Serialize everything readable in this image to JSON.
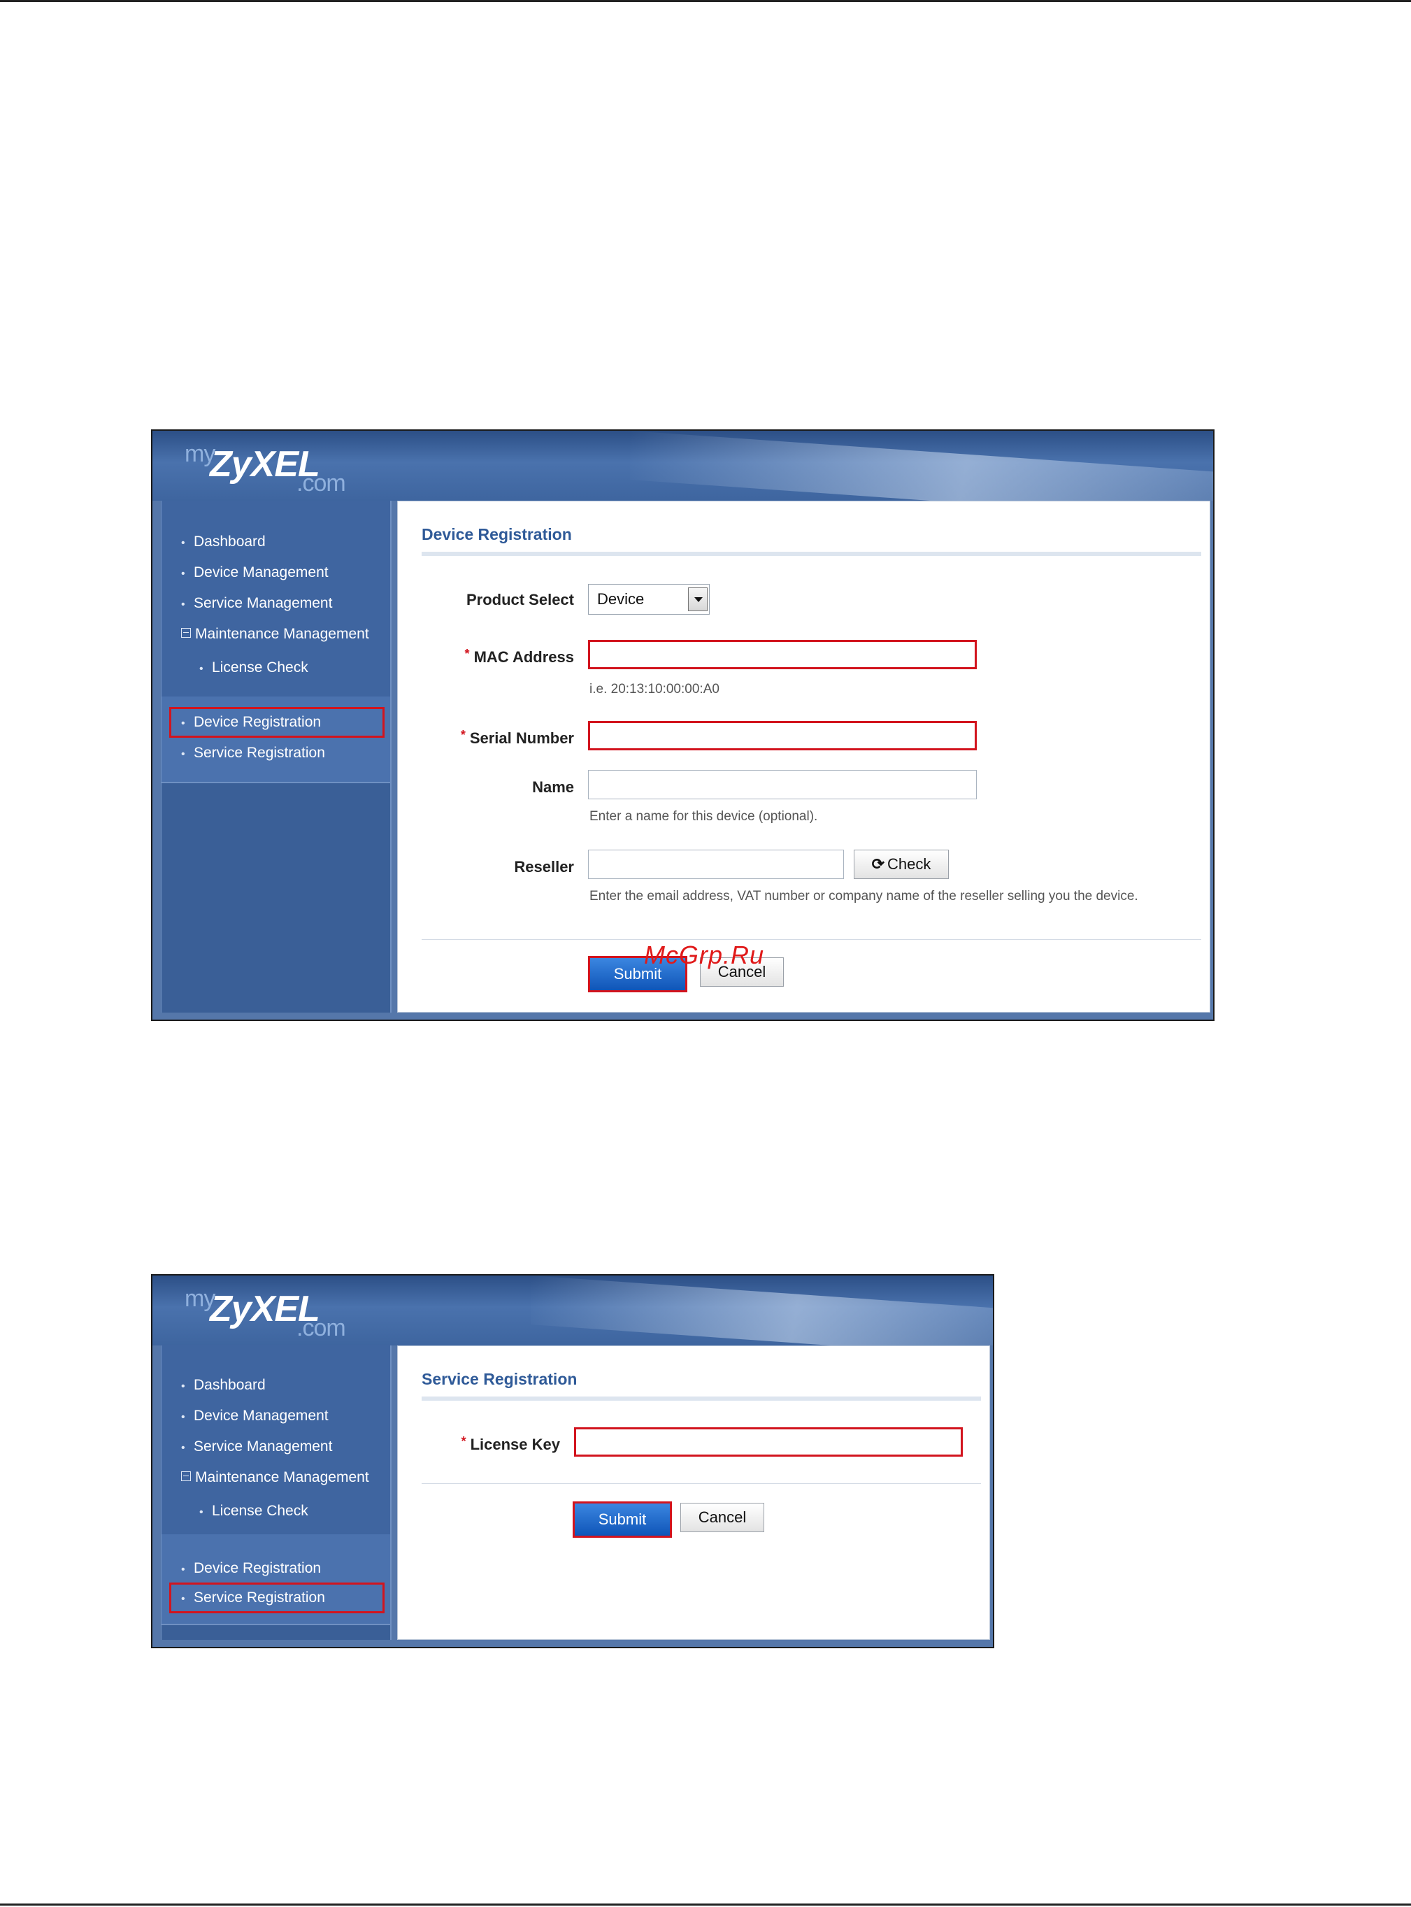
{
  "brand": {
    "my": "my",
    "name": "ZyXEL",
    "dotcom": ".com"
  },
  "sidebar": {
    "items": [
      {
        "label": "Dashboard"
      },
      {
        "label": "Device Management"
      },
      {
        "label": "Service Management"
      },
      {
        "label": "Maintenance Management"
      },
      {
        "label": "License Check"
      },
      {
        "label": "Device Registration"
      },
      {
        "label": "Service Registration"
      }
    ]
  },
  "device_registration": {
    "title": "Device Registration",
    "product_select": {
      "label": "Product Select",
      "value": "Device"
    },
    "mac_address": {
      "label": "MAC Address",
      "value": "",
      "hint": "i.e. 20:13:10:00:00:A0"
    },
    "serial_number": {
      "label": "Serial Number",
      "value": ""
    },
    "name": {
      "label": "Name",
      "value": "",
      "hint": "Enter a name for this device (optional)."
    },
    "reseller": {
      "label": "Reseller",
      "value": "",
      "check_label": "Check",
      "hint": "Enter the email address, VAT number or company name of the reseller selling you the device."
    },
    "submit_label": "Submit",
    "cancel_label": "Cancel"
  },
  "service_registration": {
    "title": "Service Registration",
    "license_key": {
      "label": "License Key",
      "value": ""
    },
    "submit_label": "Submit",
    "cancel_label": "Cancel"
  },
  "required_marker": "*",
  "watermark": "McGrp.Ru",
  "colors": {
    "banner": "#3e659f",
    "sidebar": "#3a5f97",
    "title": "#2f5a98",
    "highlight": "#d2141e",
    "primary_button": "#1a60c4"
  }
}
